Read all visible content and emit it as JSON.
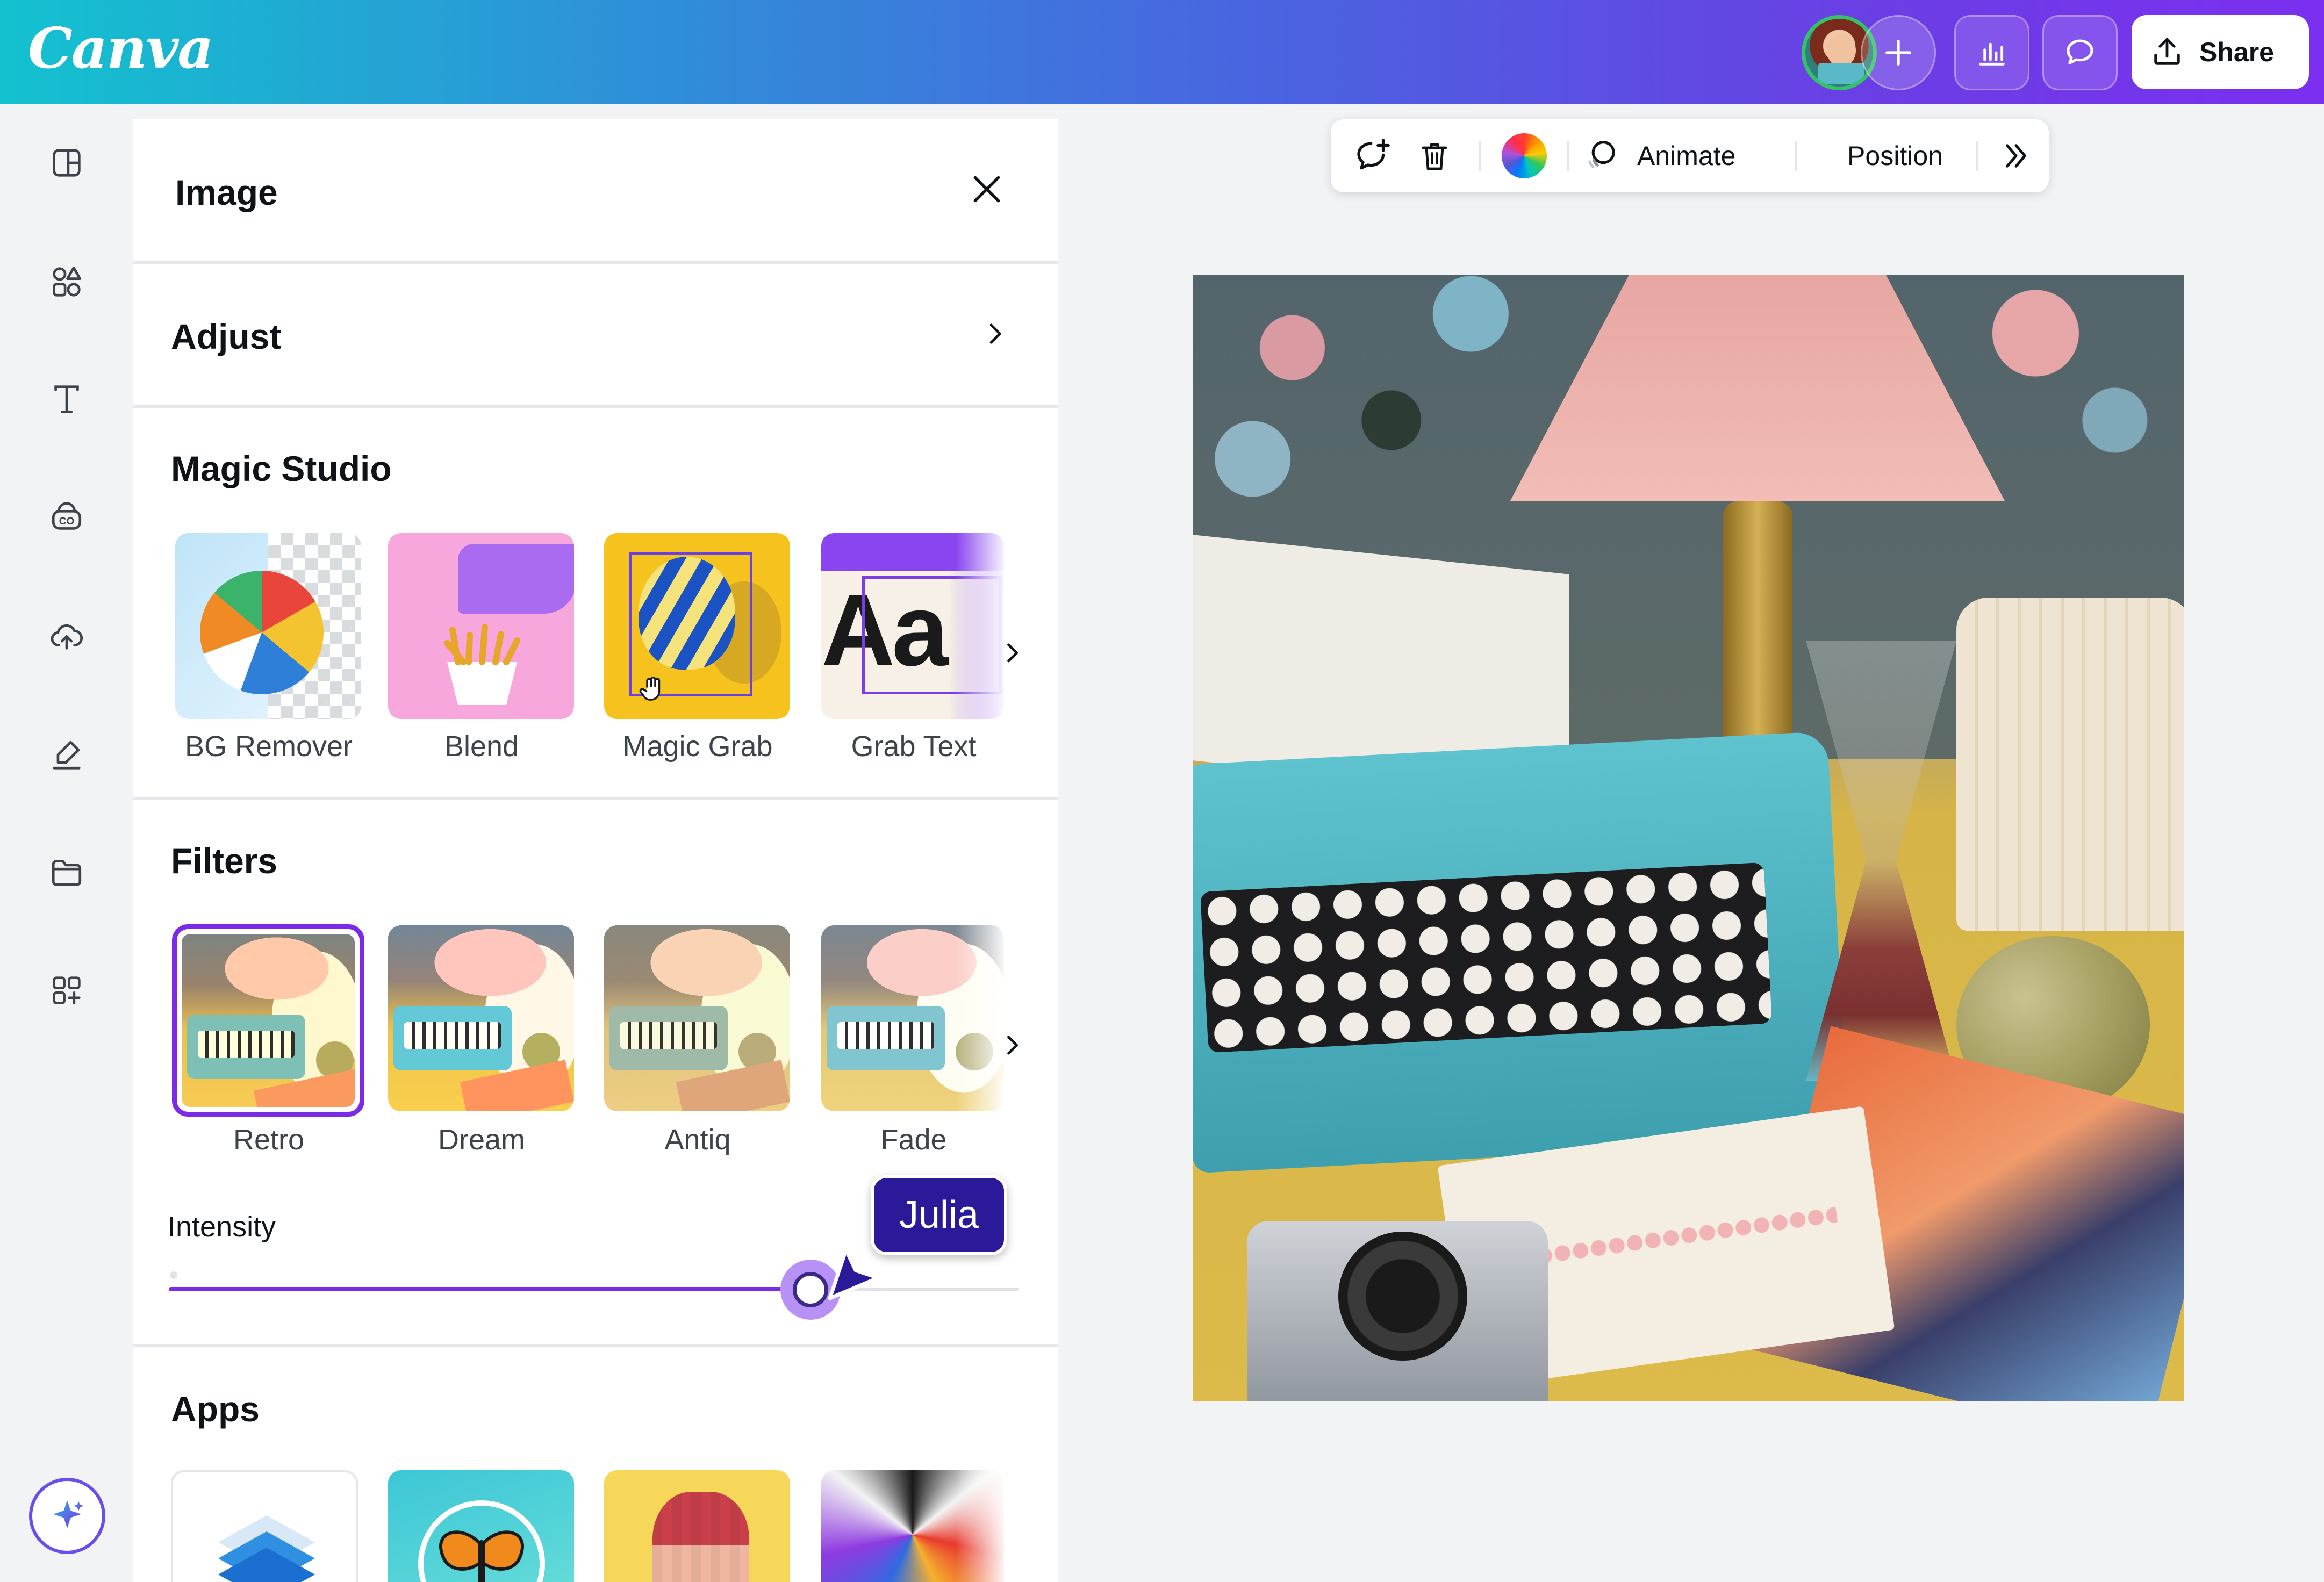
{
  "app": {
    "logo": "Canva",
    "accent": "#7d2ae8",
    "gradient_start": "#13c2cf",
    "gradient_end": "#7b2ff0"
  },
  "header": {
    "share_label": "Share",
    "icons": [
      "avatar",
      "plus-icon",
      "bar-chart-icon",
      "comment-icon",
      "upload-icon"
    ]
  },
  "rail": {
    "icons": [
      "layout-icon",
      "elements-icon",
      "text-icon",
      "brand-icon",
      "upload-cloud-icon",
      "draw-icon",
      "projects-folder-icon",
      "apps-icon",
      "magic-sparkle-icon"
    ]
  },
  "panel": {
    "title": "Image",
    "adjust_label": "Adjust",
    "magic_studio": {
      "title": "Magic Studio",
      "items": [
        {
          "label": "BG Remover"
        },
        {
          "label": "Blend"
        },
        {
          "label": "Magic Grab"
        },
        {
          "label": "Grab Text"
        }
      ]
    },
    "filters": {
      "title": "Filters",
      "items": [
        {
          "label": "Retro",
          "selected": true
        },
        {
          "label": "Dream",
          "selected": false
        },
        {
          "label": "Antiq",
          "selected": false
        },
        {
          "label": "Fade",
          "selected": false
        }
      ],
      "intensity_label": "Intensity",
      "intensity_value": 0.755
    },
    "apps": {
      "title": "Apps"
    }
  },
  "collaborator": {
    "name": "Julia"
  },
  "toolbar": {
    "animate_label": "Animate",
    "position_label": "Position"
  }
}
